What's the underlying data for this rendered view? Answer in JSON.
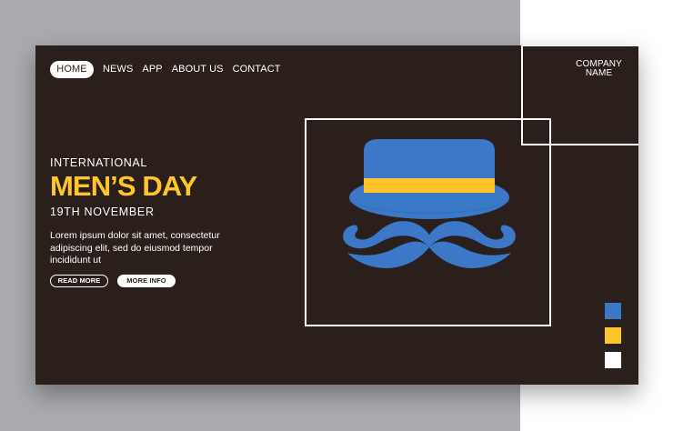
{
  "nav": {
    "items": [
      {
        "label": "HOME",
        "active": true
      },
      {
        "label": "NEWS",
        "active": false
      },
      {
        "label": "APP",
        "active": false
      },
      {
        "label": "ABOUT US",
        "active": false
      },
      {
        "label": "CONTACT",
        "active": false
      }
    ]
  },
  "brand": {
    "line1": "COMPANY",
    "line2": "NAME"
  },
  "hero": {
    "eyebrow": "INTERNATIONAL",
    "title": "MEN’S DAY",
    "date": "19TH NOVEMBER",
    "body": "Lorem ipsum dolor sit amet, consectetur adipiscing elit, sed do eiusmod tempor incididunt ut"
  },
  "actions": {
    "read_more": "READ MORE",
    "more_info": "MORE INFO"
  },
  "illustration": {
    "icons": [
      "hat-icon",
      "mustache-icon"
    ]
  },
  "colors": {
    "background_dark": "#2a1f1b",
    "accent_blue": "#3b78c7",
    "accent_gold": "#ffc62b",
    "white": "#ffffff",
    "page_gray": "#a9abb0"
  }
}
